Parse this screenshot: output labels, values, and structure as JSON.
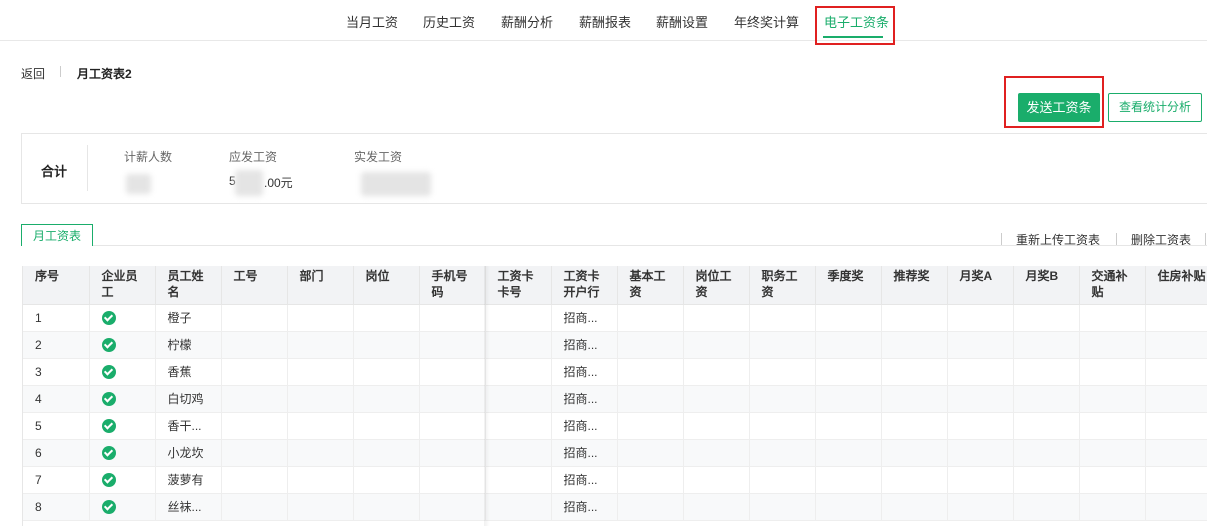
{
  "nav": {
    "tabs": [
      {
        "label": "当月工资"
      },
      {
        "label": "历史工资"
      },
      {
        "label": "薪酬分析"
      },
      {
        "label": "薪酬报表"
      },
      {
        "label": "薪酬设置"
      },
      {
        "label": "年终奖计算"
      },
      {
        "label": "电子工资条",
        "active": true
      }
    ]
  },
  "breadcrumb": {
    "back": "返回",
    "title": "月工资表2"
  },
  "actions": {
    "send": "发送工资条",
    "stats": "查看统计分析"
  },
  "summary": {
    "total_label": "合计",
    "headcount_label": "计薪人数",
    "payable_label": "应发工资",
    "payable_value_prefix": "5",
    "payable_value_suffix": ".00元",
    "actual_label": "实发工资"
  },
  "sheet": {
    "tab": "月工资表",
    "reupload": "重新上传工资表",
    "delete": "删除工资表"
  },
  "table": {
    "columns": [
      "序号",
      "企业员工",
      "员工姓名",
      "工号",
      "部门",
      "岗位",
      "手机号码",
      "工资卡卡号",
      "工资卡开户行",
      "基本工资",
      "岗位工资",
      "职务工资",
      "季度奖",
      "推荐奖",
      "月奖A",
      "月奖B",
      "交通补贴",
      "住房补贴"
    ],
    "rows": [
      {
        "no": "1",
        "name": "橙子",
        "bank": "招商..."
      },
      {
        "no": "2",
        "name": "柠檬",
        "bank": "招商..."
      },
      {
        "no": "3",
        "name": "香蕉",
        "bank": "招商..."
      },
      {
        "no": "4",
        "name": "白切鸡",
        "bank": "招商..."
      },
      {
        "no": "5",
        "name": "香干...",
        "bank": "招商..."
      },
      {
        "no": "6",
        "name": "小龙坎",
        "bank": "招商..."
      },
      {
        "no": "7",
        "name": "菠萝有",
        "bank": "招商..."
      },
      {
        "no": "8",
        "name": "丝袜...",
        "bank": "招商..."
      }
    ]
  },
  "colors": {
    "accent": "#1aad6b",
    "highlight": "#e02020"
  }
}
